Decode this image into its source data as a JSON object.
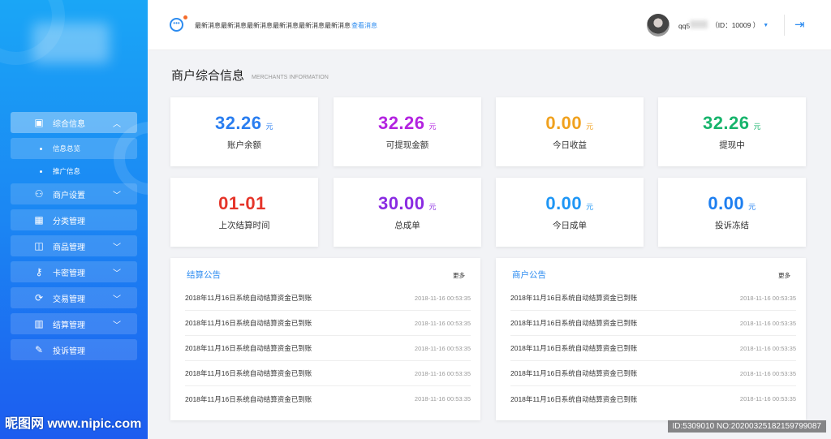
{
  "sidebar": {
    "items": [
      {
        "label": "综合信息",
        "icon": "monitor-icon",
        "glyph": "▣",
        "chev": "︿",
        "expanded": true,
        "children": [
          {
            "label": "信息总览",
            "active": true
          },
          {
            "label": "推广信息",
            "active": false
          }
        ]
      },
      {
        "label": "商户设置",
        "icon": "user-settings-icon",
        "glyph": "⚇",
        "chev": "﹀"
      },
      {
        "label": "分类管理",
        "icon": "grid-icon",
        "glyph": "▦",
        "chev": ""
      },
      {
        "label": "商品管理",
        "icon": "box-icon",
        "glyph": "◫",
        "chev": "﹀"
      },
      {
        "label": "卡密管理",
        "icon": "key-icon",
        "glyph": "⚷",
        "chev": "﹀"
      },
      {
        "label": "交易管理",
        "icon": "exchange-icon",
        "glyph": "⟳",
        "chev": "﹀"
      },
      {
        "label": "结算管理",
        "icon": "calendar-icon",
        "glyph": "▥",
        "chev": "﹀"
      },
      {
        "label": "投诉管理",
        "icon": "edit-icon",
        "glyph": "✎",
        "chev": ""
      }
    ]
  },
  "watermark": {
    "site": "昵图网 www.nipic.com",
    "id": "ID:5309010 NO:20200325182159799087"
  },
  "header": {
    "message": "最新消息最新消息最新消息最新消息最新消息最新消息",
    "view_link": "查看消息",
    "username": "qq5",
    "user_id": "（ID：10009 ）",
    "caret": "▼",
    "logout_glyph": "⇥"
  },
  "page": {
    "title": "商户综合信息",
    "subtitle": "MERCHANTS INFORMATION"
  },
  "cards": [
    {
      "value": "32.26",
      "unit": "元",
      "label": "账户余额",
      "color": "#2a7ef0"
    },
    {
      "value": "32.26",
      "unit": "元",
      "label": "可提现金额",
      "color": "#b323e0"
    },
    {
      "value": "0.00",
      "unit": "元",
      "label": "今日收益",
      "color": "#f0a11e"
    },
    {
      "value": "32.26",
      "unit": "元",
      "label": "提现中",
      "color": "#17b46c"
    },
    {
      "value": "01-01",
      "unit": "",
      "label": "上次结算时间",
      "color": "#e5352a"
    },
    {
      "value": "30.00",
      "unit": "元",
      "label": "总成单",
      "color": "#8a2be2"
    },
    {
      "value": "0.00",
      "unit": "元",
      "label": "今日成单",
      "color": "#1e96f5"
    },
    {
      "value": "0.00",
      "unit": "元",
      "label": "投诉冻结",
      "color": "#1e7ff0"
    }
  ],
  "panels": [
    {
      "title": "结算公告",
      "more": "更多",
      "rows": [
        {
          "text": "2018年11月16日系统自动结算资金已到账",
          "time": "2018-11-16    00:53:35"
        },
        {
          "text": "2018年11月16日系统自动结算资金已到账",
          "time": "2018-11-16    00:53:35"
        },
        {
          "text": "2018年11月16日系统自动结算资金已到账",
          "time": "2018-11-16    00:53:35"
        },
        {
          "text": "2018年11月16日系统自动结算资金已到账",
          "time": "2018-11-16    00:53:35"
        },
        {
          "text": "2018年11月16日系统自动结算资金已到账",
          "time": "2018-11-16    00:53:35"
        }
      ]
    },
    {
      "title": "商户公告",
      "more": "更多",
      "rows": [
        {
          "text": "2018年11月16日系统自动结算资金已到账",
          "time": "2018-11-16    00:53:35"
        },
        {
          "text": "2018年11月16日系统自动结算资金已到账",
          "time": "2018-11-16    00:53:35"
        },
        {
          "text": "2018年11月16日系统自动结算资金已到账",
          "time": "2018-11-16    00:53:35"
        },
        {
          "text": "2018年11月16日系统自动结算资金已到账",
          "time": "2018-11-16    00:53:35"
        },
        {
          "text": "2018年11月16日系统自动结算资金已到账",
          "time": "2018-11-16    00:53:35"
        }
      ]
    }
  ]
}
